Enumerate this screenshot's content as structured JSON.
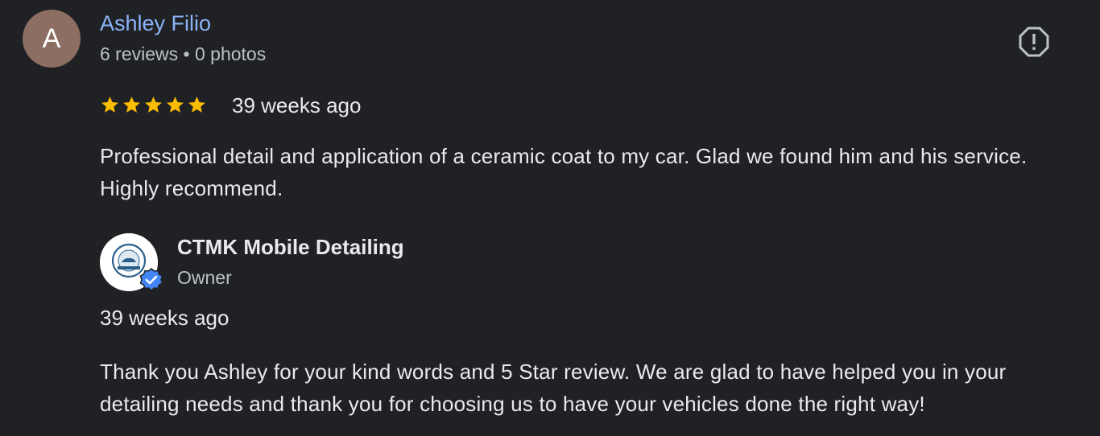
{
  "reviewer": {
    "initial": "A",
    "name": "Ashley Filio",
    "meta": "6 reviews • 0 photos",
    "avatar_color": "#8d6e63"
  },
  "review": {
    "rating": 5,
    "time": "39 weeks ago",
    "text": "Professional detail and application of a ceramic coat to my car. Glad we found him and his service. Highly recommend."
  },
  "owner_reply": {
    "name": "CTMK Mobile Detailing",
    "role": "Owner",
    "time": "39 weeks ago",
    "text": "Thank you Ashley for your kind words and 5 Star review. We are glad to have helped you in your detailing needs and thank you for choosing us to have your vehicles done the right way!",
    "logo_text": "CTMK DETAILING"
  },
  "icons": {
    "flag": "report-flag-icon",
    "star": "star-icon",
    "verified": "verified-check-icon"
  },
  "colors": {
    "background": "#202124",
    "link": "#8ab4f8",
    "star": "#fbbc04",
    "verified": "#4285f4"
  }
}
